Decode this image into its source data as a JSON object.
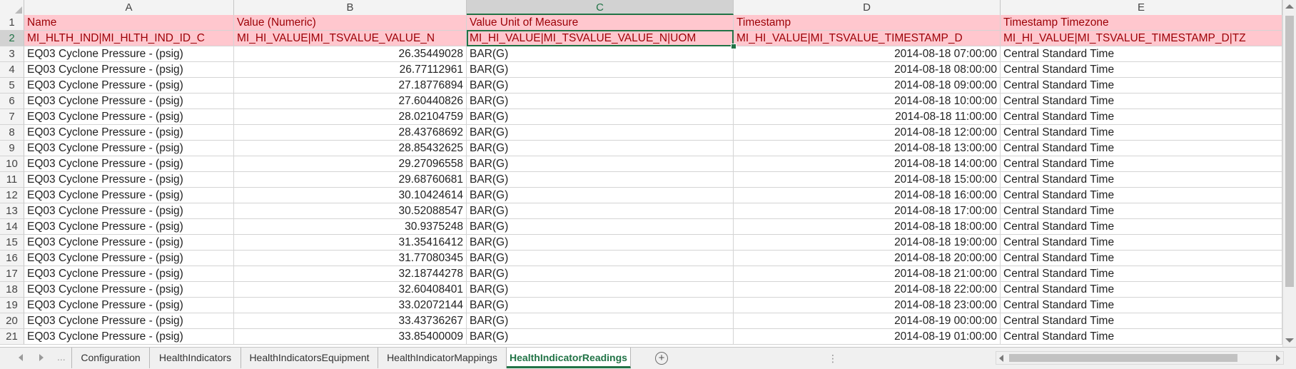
{
  "columns": [
    "A",
    "B",
    "C",
    "D",
    "E"
  ],
  "selected_column": "C",
  "header_rows": [
    [
      "Name",
      "Value (Numeric)",
      "Value Unit of Measure",
      "Timestamp",
      "Timestamp Timezone"
    ],
    [
      "MI_HLTH_IND|MI_HLTH_IND_ID_C",
      "MI_HI_VALUE|MI_TSVALUE_VALUE_N",
      "MI_HI_VALUE|MI_TSVALUE_VALUE_N|UOM",
      "MI_HI_VALUE|MI_TSVALUE_TIMESTAMP_D",
      "MI_HI_VALUE|MI_TSVALUE_TIMESTAMP_D|TZ"
    ]
  ],
  "data_rows": [
    [
      "EQ03 Cyclone Pressure - (psig)",
      "26.35449028",
      "BAR(G)",
      "2014-08-18 07:00:00",
      "Central Standard Time"
    ],
    [
      "EQ03 Cyclone Pressure - (psig)",
      "26.77112961",
      "BAR(G)",
      "2014-08-18 08:00:00",
      "Central Standard Time"
    ],
    [
      "EQ03 Cyclone Pressure - (psig)",
      "27.18776894",
      "BAR(G)",
      "2014-08-18 09:00:00",
      "Central Standard Time"
    ],
    [
      "EQ03 Cyclone Pressure - (psig)",
      "27.60440826",
      "BAR(G)",
      "2014-08-18 10:00:00",
      "Central Standard Time"
    ],
    [
      "EQ03 Cyclone Pressure - (psig)",
      "28.02104759",
      "BAR(G)",
      "2014-08-18 11:00:00",
      "Central Standard Time"
    ],
    [
      "EQ03 Cyclone Pressure - (psig)",
      "28.43768692",
      "BAR(G)",
      "2014-08-18 12:00:00",
      "Central Standard Time"
    ],
    [
      "EQ03 Cyclone Pressure - (psig)",
      "28.85432625",
      "BAR(G)",
      "2014-08-18 13:00:00",
      "Central Standard Time"
    ],
    [
      "EQ03 Cyclone Pressure - (psig)",
      "29.27096558",
      "BAR(G)",
      "2014-08-18 14:00:00",
      "Central Standard Time"
    ],
    [
      "EQ03 Cyclone Pressure - (psig)",
      "29.68760681",
      "BAR(G)",
      "2014-08-18 15:00:00",
      "Central Standard Time"
    ],
    [
      "EQ03 Cyclone Pressure - (psig)",
      "30.10424614",
      "BAR(G)",
      "2014-08-18 16:00:00",
      "Central Standard Time"
    ],
    [
      "EQ03 Cyclone Pressure - (psig)",
      "30.52088547",
      "BAR(G)",
      "2014-08-18 17:00:00",
      "Central Standard Time"
    ],
    [
      "EQ03 Cyclone Pressure - (psig)",
      "30.9375248",
      "BAR(G)",
      "2014-08-18 18:00:00",
      "Central Standard Time"
    ],
    [
      "EQ03 Cyclone Pressure - (psig)",
      "31.35416412",
      "BAR(G)",
      "2014-08-18 19:00:00",
      "Central Standard Time"
    ],
    [
      "EQ03 Cyclone Pressure - (psig)",
      "31.77080345",
      "BAR(G)",
      "2014-08-18 20:00:00",
      "Central Standard Time"
    ],
    [
      "EQ03 Cyclone Pressure - (psig)",
      "32.18744278",
      "BAR(G)",
      "2014-08-18 21:00:00",
      "Central Standard Time"
    ],
    [
      "EQ03 Cyclone Pressure - (psig)",
      "32.60408401",
      "BAR(G)",
      "2014-08-18 22:00:00",
      "Central Standard Time"
    ],
    [
      "EQ03 Cyclone Pressure - (psig)",
      "33.02072144",
      "BAR(G)",
      "2014-08-18 23:00:00",
      "Central Standard Time"
    ],
    [
      "EQ03 Cyclone Pressure - (psig)",
      "33.43736267",
      "BAR(G)",
      "2014-08-19 00:00:00",
      "Central Standard Time"
    ],
    [
      "EQ03 Cyclone Pressure - (psig)",
      "33.85400009",
      "BAR(G)",
      "2014-08-19 01:00:00",
      "Central Standard Time"
    ]
  ],
  "sheet_tabs": [
    "Configuration",
    "HealthIndicators",
    "HealthIndicatorsEquipment",
    "HealthIndicatorMappings",
    "HealthIndicatorReadings"
  ],
  "active_tab": "HealthIndicatorReadings",
  "tab_bar": {
    "overflow_glyph": "...",
    "add_glyph": "+",
    "splitter_glyph": "⋮"
  },
  "colors": {
    "header_fill": "#ffc7ce",
    "header_text": "#9c0006",
    "accent": "#217346"
  }
}
